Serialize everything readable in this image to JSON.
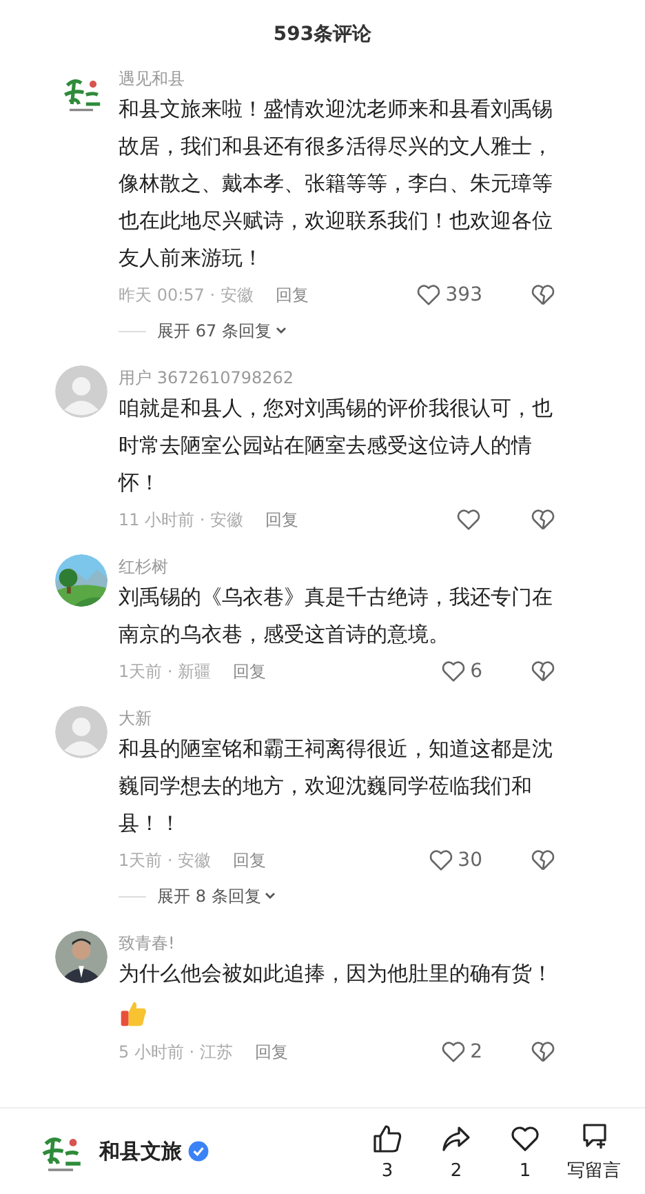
{
  "header": {
    "title": "593条评论"
  },
  "comments": [
    {
      "avatar": {
        "kind": "logo"
      },
      "user": "遇见和县",
      "text": "和县文旅来啦！盛情欢迎沈老师来和县看刘禹锡故居，我们和县还有很多活得尽兴的文人雅士，像林散之、戴本孝、张籍等等，李白、朱元璋等也在此地尽兴赋诗，欢迎联系我们！也欢迎各位友人前来游玩！",
      "time": "昨天 00:57 · 安徽",
      "reply": "回复",
      "likes": "393",
      "expand": "展开 67 条回复"
    },
    {
      "avatar": {
        "kind": "default"
      },
      "user": "用户 3672610798262",
      "text": "咱就是和县人，您对刘禹锡的评价我很认可，也时常去陋室公园站在陋室去感受这位诗人的情怀！",
      "time": "11 小时前 · 安徽",
      "reply": "回复"
    },
    {
      "user": "红杉树",
      "text": "刘禹锡的《乌衣巷》真是千古绝诗，我还专门在南京的乌衣巷，感受这首诗的意境。",
      "time": "1天前 · 新疆",
      "reply": "回复",
      "likes": "6"
    },
    {
      "avatar": {
        "kind": "default"
      },
      "user": "大新",
      "text": "和县的陋室铭和霸王祠离得很近，知道这都是沈巍同学想去的地方，欢迎沈巍同学莅临我们和县！！",
      "time": "1天前 · 安徽",
      "reply": "回复",
      "likes": "30",
      "expand": "展开 8 条回复"
    },
    {
      "avatar": {
        "kind": "person"
      },
      "user": "致青春!",
      "text": "为什么他会被如此追捧，因为他肚里的确有货！",
      "thumbs_emoji": true,
      "time": "5 小时前 · 江苏",
      "reply": "回复",
      "likes": "2"
    }
  ],
  "footer": {
    "account": "和县文旅",
    "verified": true,
    "actions": [
      {
        "kind": "like",
        "count": "3"
      },
      {
        "kind": "share",
        "count": "2"
      },
      {
        "kind": "heart",
        "count": "1"
      },
      {
        "kind": "comment",
        "count": "写留言"
      }
    ]
  }
}
